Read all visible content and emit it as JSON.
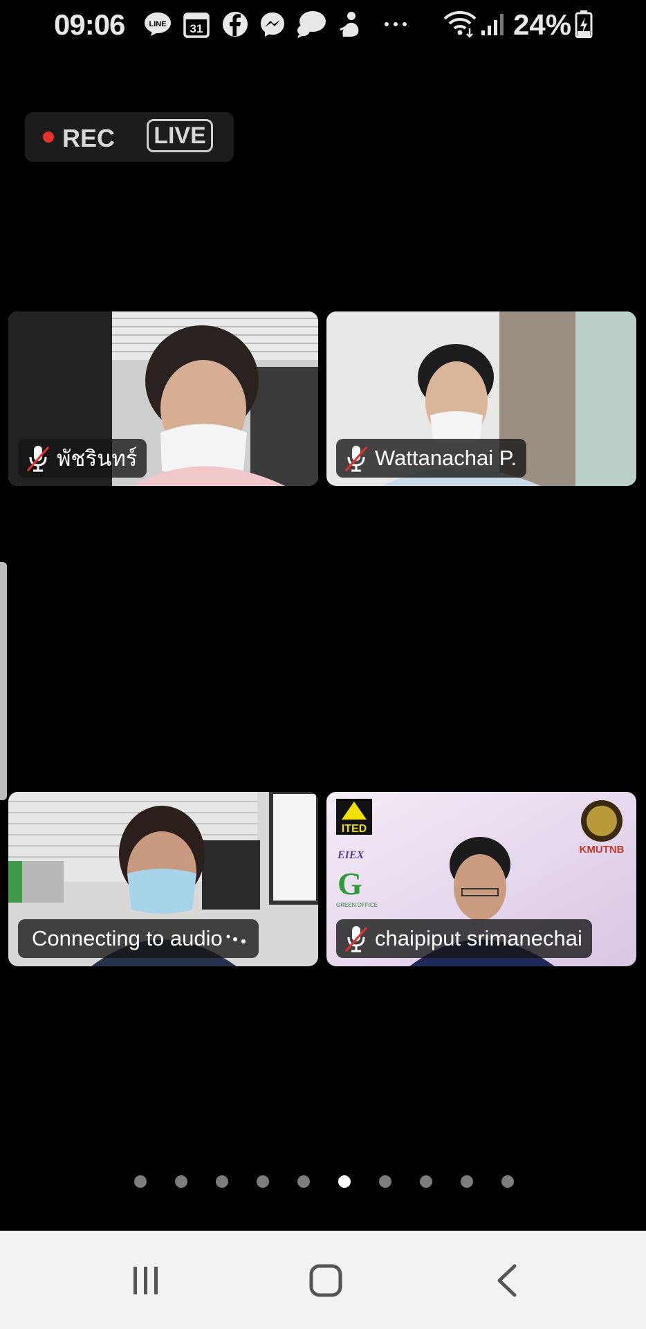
{
  "status_bar": {
    "time": "09:06",
    "notification_icons": [
      "line-icon",
      "calendar-icon",
      "facebook-icon",
      "messenger-icon",
      "chat-icon",
      "person-icon",
      "more-icon"
    ],
    "calendar_day": "31",
    "line_label": "LINE",
    "battery_percent": "24%",
    "wifi": "wifi-icon",
    "signal": "signal-icon"
  },
  "recording": {
    "rec_label": "REC",
    "live_label": "LIVE",
    "rec_color": "#e5322d"
  },
  "participants": [
    {
      "name": "พัชรินทร์",
      "muted": true
    },
    {
      "name": "Wattanachai P.",
      "muted": true
    },
    {
      "name": "Connecting to audio",
      "muted": false,
      "connecting": true
    },
    {
      "name": "chaipiput srimanechai",
      "muted": true
    }
  ],
  "logos": {
    "ited": "ITED",
    "eiex": "EIEX",
    "green_office": "GREEN OFFICE",
    "kmutnb": "KMUTNB"
  },
  "pagination": {
    "total": 10,
    "active_index": 5
  },
  "nav_bar": {
    "recents": "recents-icon",
    "home": "home-icon",
    "back": "back-icon"
  }
}
